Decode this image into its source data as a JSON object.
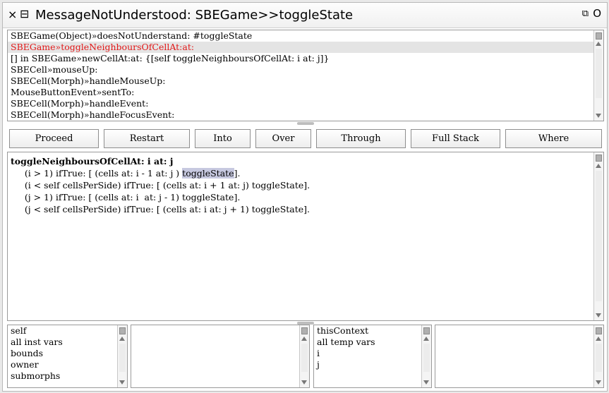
{
  "window": {
    "title": "MessageNotUnderstood: SBEGame>>toggleState",
    "close_glyph": "×",
    "menu_glyph": "⊟",
    "collapse_glyph": "⧉",
    "expand_glyph": "O"
  },
  "stack": {
    "items": [
      "SBEGame(Object)»doesNotUnderstand: #toggleState",
      "SBEGame»toggleNeighboursOfCellAt:at:",
      "[] in SBEGame»newCellAt:at: {[self toggleNeighboursOfCellAt: i at: j]}",
      "SBECell»mouseUp:",
      "SBECell(Morph)»handleMouseUp:",
      "MouseButtonEvent»sentTo:",
      "SBECell(Morph)»handleEvent:",
      "SBECell(Morph)»handleFocusEvent:"
    ],
    "selected_index": 1
  },
  "buttons": {
    "proceed": "Proceed",
    "restart": "Restart",
    "into": "Into",
    "over": "Over",
    "through": "Through",
    "full_stack": "Full Stack",
    "where": "Where"
  },
  "code": {
    "header": "toggleNeighboursOfCellAt: i at: j",
    "line1_pre": "     (i > 1) ifTrue: [ (cells at: i - 1 at: j ) ",
    "line1_hl": "toggleState",
    "line1_post": "].",
    "line2": "     (i < self cellsPerSide) ifTrue: [ (cells at: i + 1 at: j) toggleState].",
    "line3": "     (j > 1) ifTrue: [ (cells at: i  at: j - 1) toggleState].",
    "line4": "     (j < self cellsPerSide) ifTrue: [ (cells at: i at: j + 1) toggleState]."
  },
  "receiver_inspector": {
    "fields": [
      "self",
      "all inst vars",
      "bounds",
      "owner",
      "submorphs"
    ]
  },
  "context_inspector": {
    "fields": [
      "thisContext",
      "all temp vars",
      "i",
      "j"
    ]
  },
  "colors": {
    "selected_stack_text": "#e21919",
    "selection_bg": "#e4e4e4",
    "code_highlight": "#c7c9e0"
  }
}
